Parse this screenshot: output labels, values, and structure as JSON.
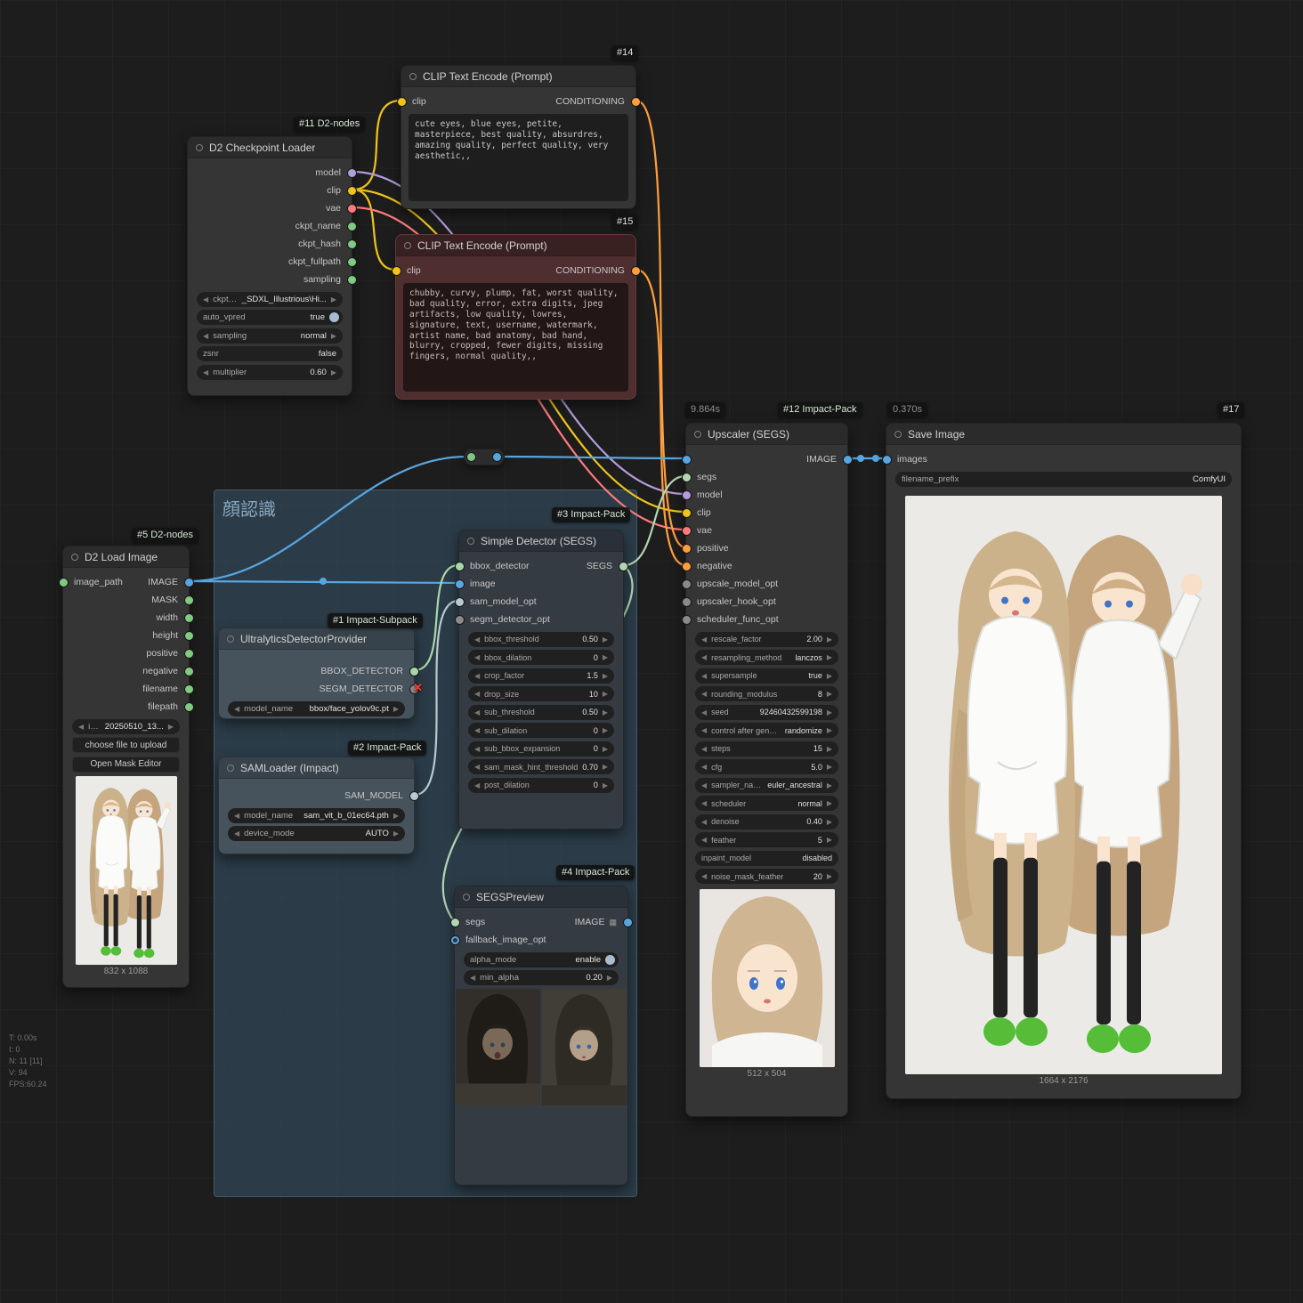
{
  "stats": {
    "line1": "T: 0.00s",
    "line2": "I: 0",
    "line3": "N: 11 [11]",
    "line4": "V: 94",
    "line5": "FPS:60.24"
  },
  "group": {
    "title": "顔認識"
  },
  "colors": {
    "model": "#b39ddb",
    "clip": "#f0c419",
    "vae": "#ff7a7a",
    "conditioning": "#ff9e3d",
    "image": "#58a6e0",
    "string": "#82c982",
    "bbox_detector": "#a8d8a8",
    "segs": "#b2d6b2",
    "sam_model": "#b7c9d1",
    "error": "#ff3b30",
    "group_bg": "#3a5e78",
    "negative_node_bg": "#4e2e2e"
  },
  "nodes": {
    "checkpoint": {
      "badge": "#11 D2-nodes",
      "title": "D2 Checkpoint Loader",
      "outputs": [
        "model",
        "clip",
        "vae",
        "ckpt_name",
        "ckpt_hash",
        "ckpt_fullpath",
        "sampling"
      ],
      "widgets": {
        "ckpt_name": {
          "label": "ckpt_name",
          "value": "_SDXL_Illustrious\\Hi..."
        },
        "auto_vpred": {
          "label": "auto_vpred",
          "value": "true"
        },
        "sampling": {
          "label": "sampling",
          "value": "normal"
        },
        "zsnr": {
          "label": "zsnr",
          "value": "false"
        },
        "multiplier": {
          "label": "multiplier",
          "value": "0.60"
        }
      }
    },
    "clip_pos": {
      "badge": "#14",
      "title": "CLIP Text Encode (Prompt)",
      "input": "clip",
      "output": "CONDITIONING",
      "text": "cute eyes, blue eyes, petite, masterpiece, best quality, absurdres, amazing quality, perfect quality, very aesthetic,,"
    },
    "clip_neg": {
      "badge": "#15",
      "title": "CLIP Text Encode (Prompt)",
      "input": "clip",
      "output": "CONDITIONING",
      "text": "chubby, curvy, plump, fat, worst quality, bad quality, error, extra digits, jpeg artifacts, low quality, lowres, signature, text, username, watermark, artist name, bad anatomy, bad hand, blurry, cropped, fewer digits, missing fingers, normal quality,,"
    },
    "load_image": {
      "badge": "#5 D2-nodes",
      "title": "D2 Load Image",
      "input": "image_path",
      "outputs": [
        "IMAGE",
        "MASK",
        "width",
        "height",
        "positive",
        "negative",
        "filename",
        "filepath"
      ],
      "widgets": {
        "image": {
          "label": "image",
          "value": "20250510_13..."
        }
      },
      "buttons": {
        "upload": "choose file to upload",
        "mask_editor": "Open Mask Editor"
      },
      "caption": "832 x 1088"
    },
    "ultralytics": {
      "badge": "#1 Impact-Subpack",
      "title": "UltralyticsDetectorProvider",
      "outputs": [
        "BBOX_DETECTOR",
        "SEGM_DETECTOR"
      ],
      "widgets": {
        "model_name": {
          "label": "model_name",
          "value": "bbox/face_yolov9c.pt"
        }
      }
    },
    "sam_loader": {
      "badge": "#2 Impact-Pack",
      "title": "SAMLoader (Impact)",
      "outputs": [
        "SAM_MODEL"
      ],
      "widgets": {
        "model_name": {
          "label": "model_name",
          "value": "sam_vit_b_01ec64.pth"
        },
        "device_mode": {
          "label": "device_mode",
          "value": "AUTO"
        }
      }
    },
    "detector": {
      "badge": "#3 Impact-Pack",
      "title": "Simple Detector (SEGS)",
      "inputs": [
        "bbox_detector",
        "image",
        "sam_model_opt",
        "segm_detector_opt"
      ],
      "output": "SEGS",
      "widgets": [
        {
          "label": "bbox_threshold",
          "value": "0.50"
        },
        {
          "label": "bbox_dilation",
          "value": "0"
        },
        {
          "label": "crop_factor",
          "value": "1.5"
        },
        {
          "label": "drop_size",
          "value": "10"
        },
        {
          "label": "sub_threshold",
          "value": "0.50"
        },
        {
          "label": "sub_dilation",
          "value": "0"
        },
        {
          "label": "sub_bbox_expansion",
          "value": "0"
        },
        {
          "label": "sam_mask_hint_threshold",
          "value": "0.70"
        },
        {
          "label": "post_dilation",
          "value": "0"
        }
      ]
    },
    "segs_preview": {
      "badge": "#4 Impact-Pack",
      "title": "SEGSPreview",
      "inputs": [
        "segs",
        "fallback_image_opt"
      ],
      "output": "IMAGE",
      "widgets": {
        "alpha_mode": {
          "label": "alpha_mode",
          "value": "enable"
        },
        "min_alpha": {
          "label": "min_alpha",
          "value": "0.20"
        }
      }
    },
    "upscaler": {
      "time": "9.864s",
      "badge": "#12 Impact-Pack",
      "title": "Upscaler (SEGS)",
      "inputs": [
        "image",
        "segs",
        "model",
        "clip",
        "vae",
        "positive",
        "negative",
        "upscale_model_opt",
        "upscaler_hook_opt",
        "scheduler_func_opt"
      ],
      "output": "IMAGE",
      "widgets": [
        {
          "label": "rescale_factor",
          "value": "2.00"
        },
        {
          "label": "resampling_method",
          "value": "lanczos"
        },
        {
          "label": "supersample",
          "value": "true"
        },
        {
          "label": "rounding_modulus",
          "value": "8"
        },
        {
          "label": "seed",
          "value": "92460432599198"
        },
        {
          "label": "control after generate",
          "value": "randomize"
        },
        {
          "label": "steps",
          "value": "15"
        },
        {
          "label": "cfg",
          "value": "5.0"
        },
        {
          "label": "sampler_name",
          "value": "euler_ancestral"
        },
        {
          "label": "scheduler",
          "value": "normal"
        },
        {
          "label": "denoise",
          "value": "0.40"
        },
        {
          "label": "feather",
          "value": "5"
        },
        {
          "label": "inpaint_model",
          "value": "disabled"
        },
        {
          "label": "noise_mask_feather",
          "value": "20"
        }
      ],
      "caption": "512 x 504"
    },
    "save_image": {
      "time": "0.370s",
      "badge": "#17",
      "title": "Save Image",
      "input": "images",
      "widgets": {
        "filename_prefix": {
          "label": "filename_prefix",
          "value": "ComfyUI"
        }
      },
      "caption": "1664 x 2176"
    }
  }
}
